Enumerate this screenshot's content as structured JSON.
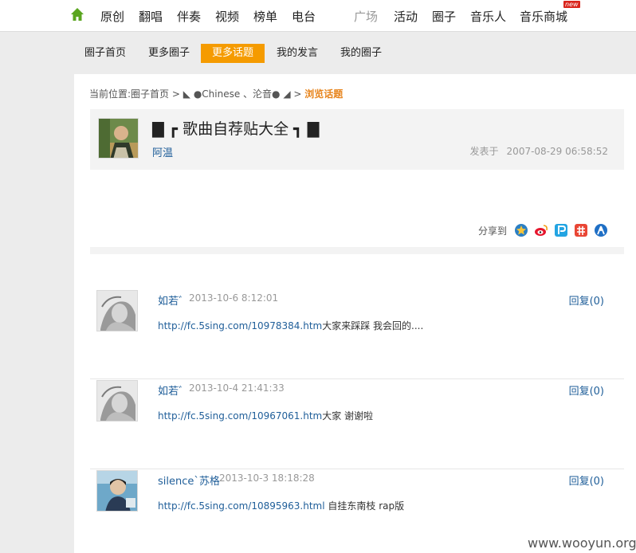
{
  "topnav": {
    "items": [
      "原创",
      "翻唱",
      "伴奏",
      "视频",
      "榜单",
      "电台",
      "广场",
      "活动",
      "圈子",
      "音乐人",
      "音乐商城"
    ],
    "new_badge": "new",
    "home_icon": "home-icon",
    "accent_color": "#5aa51f"
  },
  "subnav": {
    "items": [
      "圈子首页",
      "更多圈子",
      "更多话题",
      "我的发言",
      "我的圈子"
    ],
    "active_color": "#f59b00"
  },
  "breadcrumb": {
    "prefix": "当前位置:",
    "home": "圈子首页",
    "sep1": ">",
    "circle": "◣ ●Chinese 、沦音● ◢",
    "sep2": ">",
    "current": "浏览话题"
  },
  "topic": {
    "title": "▇ ┏  歌曲自荐贴大全  ┓ ▇",
    "author": "阿温",
    "posted_label": "发表于",
    "posted_time": "2007-08-29 06:58:52"
  },
  "share": {
    "label": "分享到",
    "icons": [
      "qzone-icon",
      "weibo-icon",
      "pengyou-icon",
      "kaixin-icon",
      "renren-icon"
    ]
  },
  "replies": [
    {
      "user": "如若゛",
      "time": "2013-10-6 8:12:01",
      "reply_label": "回复(0)",
      "link": "http://fc.5sing.com/10978384.htm",
      "text": "大家来踩踩 我会回的...."
    },
    {
      "user": "如若゛",
      "time": "2013-10-4 21:41:33",
      "reply_label": "回复(0)",
      "link": "http://fc.5sing.com/10967061.htm",
      "text": "大家 谢谢啦"
    },
    {
      "user": "silence`苏格",
      "time": "2013-10-3 18:18:28",
      "reply_label": "回复(0)",
      "link": "http://fc.5sing.com/10895963.html",
      "text": " 自挂东南枝 rap版"
    }
  ],
  "watermark": "www.wooyun.org"
}
